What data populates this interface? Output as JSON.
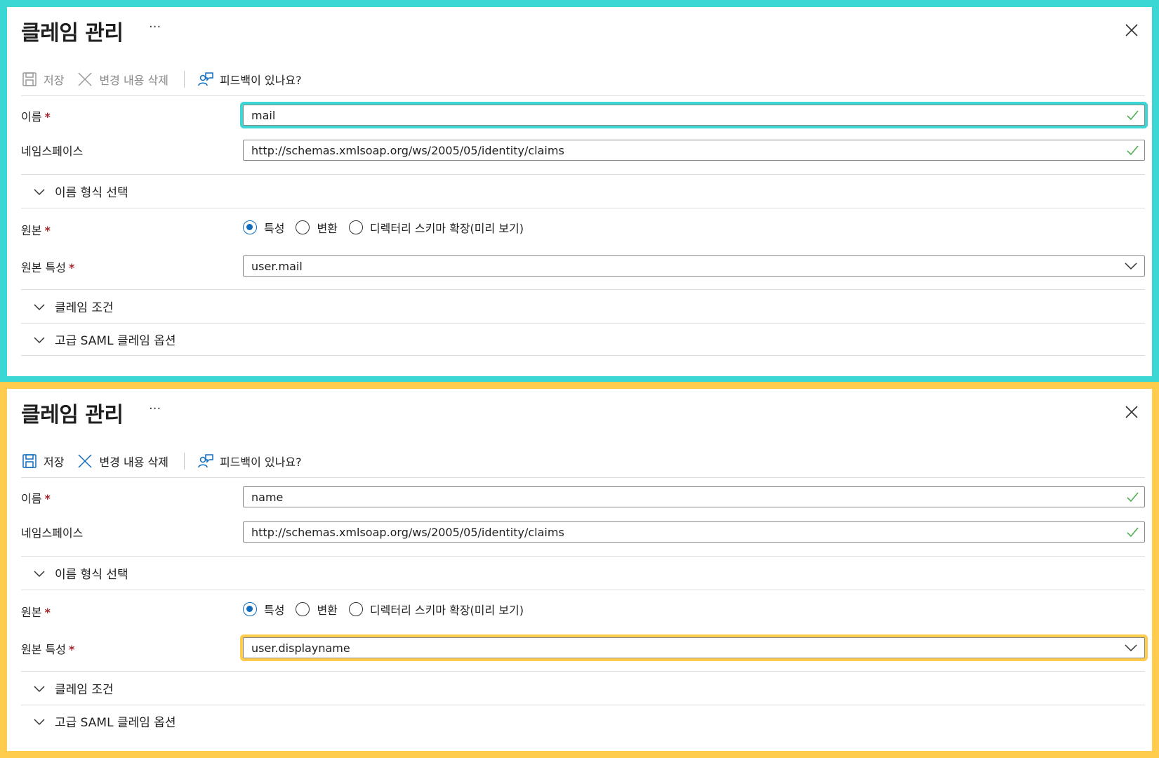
{
  "colors": {
    "accent": "#0f6cbd",
    "valid_check": "#4caf50",
    "required": "#a4262c",
    "highlight_top": "#3ad7d5",
    "highlight_bottom": "#ffcc4d"
  },
  "panels": [
    {
      "title": "클레임 관리",
      "more_label": "···",
      "toolbar": {
        "save_label": "저장",
        "discard_label": "변경 내용 삭제",
        "feedback_label": "피드백이 있나요?"
      },
      "name": {
        "label": "이름",
        "required_mark": "*",
        "value": "mail"
      },
      "namespace": {
        "label": "네임스페이스",
        "value": "http://schemas.xmlsoap.org/ws/2005/05/identity/claims"
      },
      "name_format_section": "이름 형식 선택",
      "source": {
        "label": "원본",
        "required_mark": "*",
        "options": [
          "특성",
          "변환",
          "디렉터리 스키마 확장(미리 보기)"
        ],
        "selected": "특성"
      },
      "source_attribute": {
        "label": "원본 특성",
        "required_mark": "*",
        "value": "user.mail"
      },
      "claim_conditions_section": "클레임 조건",
      "advanced_section": "고급 SAML 클레임 옵션"
    },
    {
      "title": "클레임 관리",
      "more_label": "···",
      "toolbar": {
        "save_label": "저장",
        "discard_label": "변경 내용 삭제",
        "feedback_label": "피드백이 있나요?"
      },
      "name": {
        "label": "이름",
        "required_mark": "*",
        "value": "name"
      },
      "namespace": {
        "label": "네임스페이스",
        "value": "http://schemas.xmlsoap.org/ws/2005/05/identity/claims"
      },
      "name_format_section": "이름 형식 선택",
      "source": {
        "label": "원본",
        "required_mark": "*",
        "options": [
          "특성",
          "변환",
          "디렉터리 스키마 확장(미리 보기)"
        ],
        "selected": "특성"
      },
      "source_attribute": {
        "label": "원본 특성",
        "required_mark": "*",
        "value": "user.displayname"
      },
      "claim_conditions_section": "클레임 조건",
      "advanced_section": "고급 SAML 클레임 옵션"
    }
  ]
}
